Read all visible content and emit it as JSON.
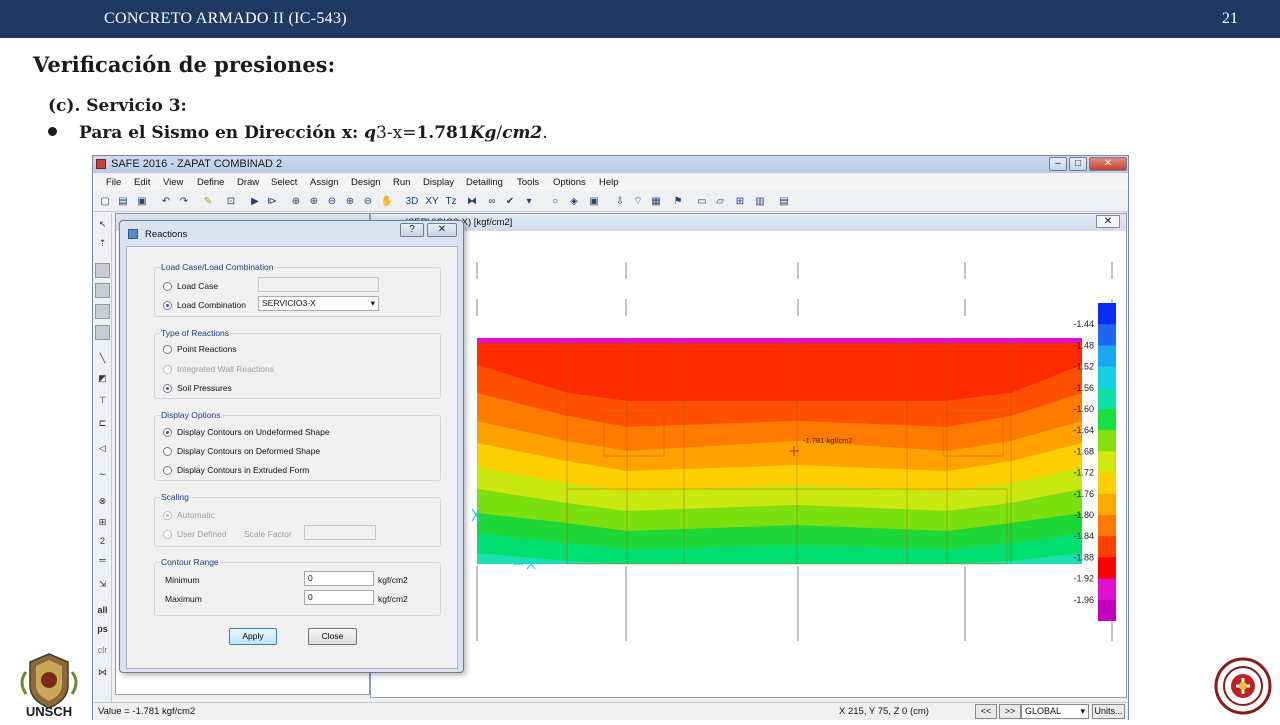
{
  "slide": {
    "course": "CONCRETO ARMADO II (IC-543)",
    "page_number": "21",
    "title": "Verificación de presiones:",
    "subtitle": "(c). Servicio 3:",
    "bullet_prefix": "Para el Sismo en Dirección x: ",
    "bullet_math1": "q",
    "bullet_mid": "3-x=",
    "bullet_value": "1.781",
    "bullet_math2": "Kg",
    "bullet_slash": "/",
    "bullet_math3": "cm2",
    "bullet_end": ".",
    "logo_left_text": "UNSCH"
  },
  "app": {
    "title": "SAFE 2016 - ZAPAT COMBINAD 2",
    "menu": [
      "File",
      "Edit",
      "View",
      "Define",
      "Draw",
      "Select",
      "Assign",
      "Design",
      "Run",
      "Display",
      "Detailing",
      "Tools",
      "Options",
      "Help"
    ],
    "toolbar_labels": {
      "t3d": "3D",
      "txy": "XY",
      "tz": "Tz"
    },
    "left_tools": {
      "all": "all",
      "ps": "ps",
      "clr": "clr",
      "two": "2"
    },
    "plot_title": "ram - (SERVICIO3-X)  [kgf/cm2]",
    "plot_close": "✕",
    "point_label": "-1.781 kgf/cm2",
    "status_value": "Value = -1.781 kgf/cm2",
    "status_coords": "X 215,  Y 75,  Z 0   (cm)",
    "nav_prev": "<<",
    "nav_next": ">>",
    "coord_system": "GLOBAL",
    "units_button": "Units..."
  },
  "dialog": {
    "title": "Reactions",
    "help": "?",
    "close": "✕",
    "group_load": "Load Case/Load Combination",
    "opt_load_case": "Load Case",
    "opt_load_combination": "Load Combination",
    "combination_value": "SERVICIO3-X",
    "group_type": "Type of Reactions",
    "opt_point": "Point Reactions",
    "opt_wall": "Integrated Wall Reactions",
    "opt_soil": "Soil Pressures",
    "group_display": "Display Options",
    "opt_undeformed": "Display Contours on Undeformed Shape",
    "opt_deformed": "Display Contours on Deformed Shape",
    "opt_extruded": "Display Contours in Extruded Form",
    "group_scaling": "Scaling",
    "opt_automatic": "Automatic",
    "opt_user_defined": "User Defined",
    "scale_factor_label": "Scale Factor",
    "group_contour": "Contour Range",
    "minimum_label": "Minimum",
    "maximum_label": "Maximum",
    "minimum_value": "0",
    "maximum_value": "0",
    "unit": "kgf/cm2",
    "apply": "Apply",
    "close_button": "Close"
  },
  "legend": {
    "labels": [
      "-1.44",
      "-1.48",
      "-1.52",
      "-1.56",
      "-1.60",
      "-1.64",
      "-1.68",
      "-1.72",
      "-1.76",
      "-1.80",
      "-1.84",
      "-1.88",
      "-1.92",
      "-1.96"
    ],
    "colors": [
      "#0a2bf0",
      "#1f66f5",
      "#1aa6f0",
      "#18d0e6",
      "#10e0a8",
      "#18e040",
      "#86e010",
      "#d2e810",
      "#ffd000",
      "#ffa800",
      "#ff7a00",
      "#ff4000",
      "#ff0000",
      "#e010d0",
      "#c000c0"
    ]
  }
}
